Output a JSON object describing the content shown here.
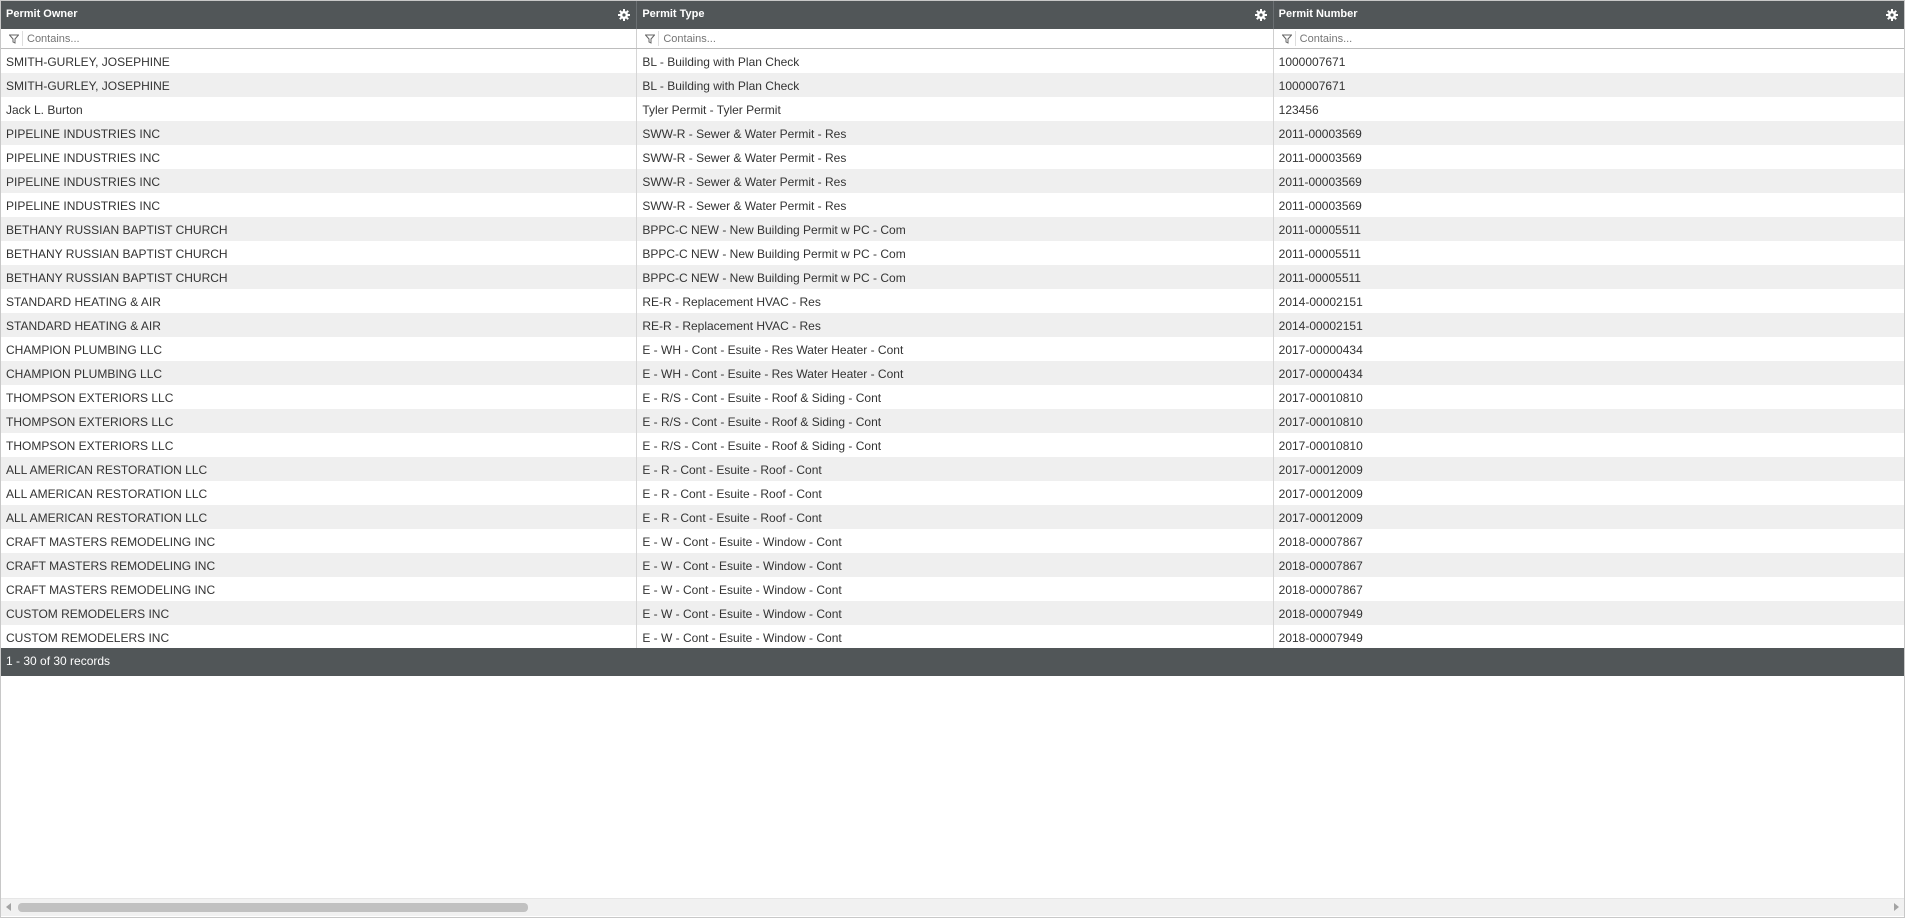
{
  "columns": [
    {
      "label": "Permit Owner",
      "filter_placeholder": "Contains..."
    },
    {
      "label": "Permit Type",
      "filter_placeholder": "Contains..."
    },
    {
      "label": "Permit Number",
      "filter_placeholder": "Contains..."
    }
  ],
  "rows": [
    [
      "SMITH-GURLEY, JOSEPHINE",
      "BL - Building with Plan Check",
      "1000007671"
    ],
    [
      "SMITH-GURLEY, JOSEPHINE",
      "BL - Building with Plan Check",
      "1000007671"
    ],
    [
      "Jack L. Burton",
      "Tyler Permit - Tyler Permit",
      "123456"
    ],
    [
      "PIPELINE INDUSTRIES INC",
      "SWW-R - Sewer & Water Permit - Res",
      "2011-00003569"
    ],
    [
      "PIPELINE INDUSTRIES INC",
      "SWW-R - Sewer & Water Permit - Res",
      "2011-00003569"
    ],
    [
      "PIPELINE INDUSTRIES INC",
      "SWW-R - Sewer & Water Permit - Res",
      "2011-00003569"
    ],
    [
      "PIPELINE INDUSTRIES INC",
      "SWW-R - Sewer & Water Permit - Res",
      "2011-00003569"
    ],
    [
      "BETHANY RUSSIAN BAPTIST CHURCH",
      "BPPC-C NEW - New Building Permit w PC - Com",
      "2011-00005511"
    ],
    [
      "BETHANY RUSSIAN BAPTIST CHURCH",
      "BPPC-C NEW - New Building Permit w PC - Com",
      "2011-00005511"
    ],
    [
      "BETHANY RUSSIAN BAPTIST CHURCH",
      "BPPC-C NEW - New Building Permit w PC - Com",
      "2011-00005511"
    ],
    [
      "STANDARD HEATING & AIR",
      "RE-R - Replacement HVAC - Res",
      "2014-00002151"
    ],
    [
      "STANDARD HEATING & AIR",
      "RE-R - Replacement HVAC - Res",
      "2014-00002151"
    ],
    [
      "CHAMPION PLUMBING LLC",
      "E - WH - Cont - Esuite - Res Water Heater - Cont",
      "2017-00000434"
    ],
    [
      "CHAMPION PLUMBING LLC",
      "E - WH - Cont - Esuite - Res Water Heater - Cont",
      "2017-00000434"
    ],
    [
      "THOMPSON EXTERIORS LLC",
      "E - R/S - Cont - Esuite - Roof & Siding - Cont",
      "2017-00010810"
    ],
    [
      "THOMPSON EXTERIORS LLC",
      "E - R/S - Cont - Esuite - Roof & Siding - Cont",
      "2017-00010810"
    ],
    [
      "THOMPSON EXTERIORS LLC",
      "E - R/S - Cont - Esuite - Roof & Siding - Cont",
      "2017-00010810"
    ],
    [
      "ALL AMERICAN RESTORATION LLC",
      "E - R - Cont - Esuite - Roof - Cont",
      "2017-00012009"
    ],
    [
      "ALL AMERICAN RESTORATION LLC",
      "E - R - Cont - Esuite - Roof - Cont",
      "2017-00012009"
    ],
    [
      "ALL AMERICAN RESTORATION LLC",
      "E - R - Cont - Esuite - Roof - Cont",
      "2017-00012009"
    ],
    [
      "CRAFT MASTERS REMODELING INC",
      "E - W - Cont - Esuite - Window - Cont",
      "2018-00007867"
    ],
    [
      "CRAFT MASTERS REMODELING INC",
      "E - W - Cont - Esuite - Window - Cont",
      "2018-00007867"
    ],
    [
      "CRAFT MASTERS REMODELING INC",
      "E - W - Cont - Esuite - Window - Cont",
      "2018-00007867"
    ],
    [
      "CUSTOM REMODELERS INC",
      "E - W - Cont - Esuite - Window - Cont",
      "2018-00007949"
    ],
    [
      "CUSTOM REMODELERS INC",
      "E - W - Cont - Esuite - Window - Cont",
      "2018-00007949"
    ]
  ],
  "footer": {
    "records_text": "1 - 30 of 30 records"
  },
  "icons": {
    "header": "gear-icon",
    "filter": "funnel-icon"
  },
  "colors": {
    "header_bg": "#515658",
    "row_alt_bg": "#efefef"
  }
}
